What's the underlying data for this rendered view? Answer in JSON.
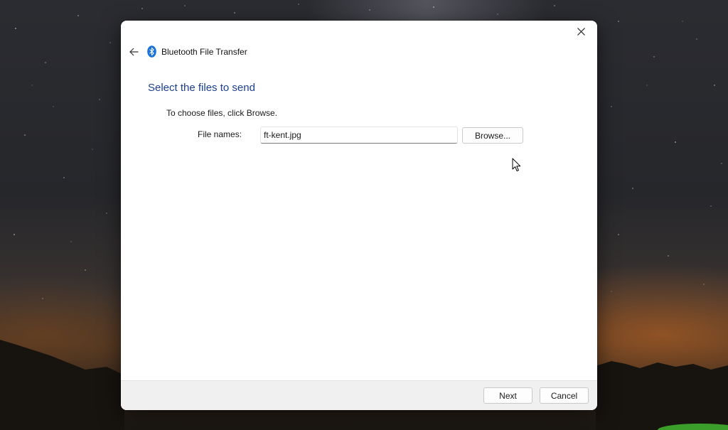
{
  "window": {
    "title": "Bluetooth File Transfer",
    "close_icon": "close-icon",
    "back_icon": "back-arrow-icon",
    "app_icon": "bluetooth-icon",
    "accent_color": "#1d3f8e",
    "bluetooth_color": "#1a73d9"
  },
  "content": {
    "heading": "Select the files to send",
    "instruction": "To choose files, click Browse.",
    "file_label": "File names:",
    "file_value": "ft-kent.jpg",
    "browse_label": "Browse..."
  },
  "footer": {
    "next_label": "Next",
    "cancel_label": "Cancel"
  }
}
